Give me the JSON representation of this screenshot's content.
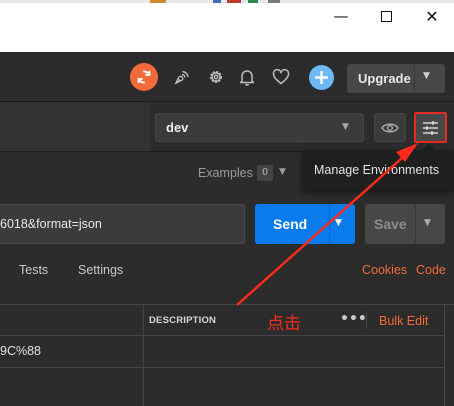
{
  "window": {
    "minimize_glyph": "—",
    "close_glyph": "✕"
  },
  "header": {
    "icons": [
      "sync-icon",
      "satellite-icon",
      "gear-icon",
      "bell-icon",
      "heart-icon",
      "plus-icon"
    ],
    "upgrade_label": "Upgrade",
    "caret_glyph": "▼"
  },
  "environment": {
    "selected": "dev",
    "tooltip": "Manage Environments"
  },
  "examples": {
    "label": "Examples",
    "count": "0"
  },
  "request": {
    "url_visible": "6018&format=json",
    "send_label": "Send",
    "save_label": "Save"
  },
  "tabs": {
    "tests": "Tests",
    "settings": "Settings",
    "cookies": "Cookies",
    "code": "Code"
  },
  "params_table": {
    "description_header": "DESCRIPTION",
    "more_glyph": "•••",
    "bulk_edit": "Bulk Edit",
    "rows": [
      {
        "key_fragment": "9C%88"
      }
    ]
  },
  "annotation": {
    "text": "点击",
    "color": "#ff2a1a"
  },
  "colors": {
    "accent_orange": "#f26b3a",
    "send_blue": "#097bed",
    "plus_blue": "#6db8f7",
    "highlight_red": "#e52b20",
    "background": "#2c2c2c"
  }
}
